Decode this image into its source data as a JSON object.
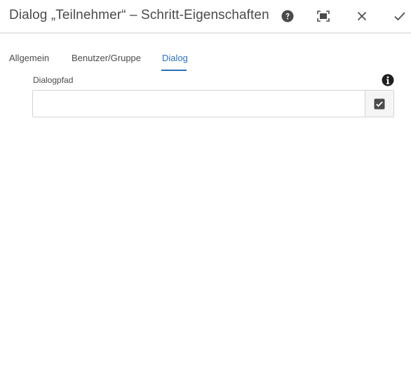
{
  "dialog": {
    "title": "Dialog „Teilnehmer“ – Schritt-Eigenschaften",
    "header_icons": [
      "help-icon",
      "fullscreen-icon",
      "close-icon",
      "checkmark-icon"
    ]
  },
  "tabs": [
    {
      "label": "Allgemein",
      "selected": false
    },
    {
      "label": "Benutzer/Gruppe",
      "selected": false
    },
    {
      "label": "Dialog",
      "selected": true
    }
  ],
  "field": {
    "label": "Dialogpfad",
    "value": "",
    "info_icon": "info-icon",
    "picker_icon": "checkbox-check-icon"
  },
  "colors": {
    "accent": "#2c6fb8",
    "text": "#4b4b4b",
    "icon": "#4b4b4b",
    "border": "#d3d3d3"
  }
}
